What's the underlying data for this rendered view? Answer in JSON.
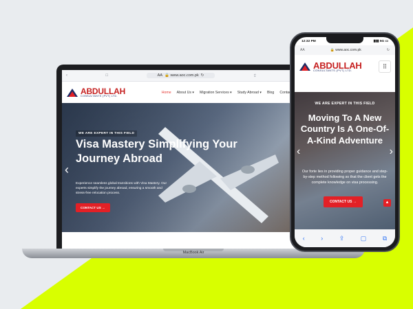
{
  "colors": {
    "brand_red": "#e32026",
    "lime": "#d8ff00",
    "navy": "#1d2b64"
  },
  "laptop": {
    "url": "www.aoc.com.pk",
    "aa": "AA",
    "base_label": "MacBook Air",
    "logo": {
      "main": "ABDULLAH",
      "sub": "CONSULTANTS (PVT) LTD."
    },
    "nav": [
      {
        "label": "Home",
        "active": true
      },
      {
        "label": "About Us ▾"
      },
      {
        "label": "Migration Services ▾"
      },
      {
        "label": "Study Abroad ▾"
      },
      {
        "label": "Blog"
      },
      {
        "label": "Contact Us"
      }
    ],
    "hero": {
      "eyebrow": "WE ARE EXPERT IN THIS FIELD",
      "title": "Visa Mastery Simplifying Your Journey Abroad",
      "description": "Experience seamless global transitions with Visa Mastery. Our experts simplify the journey abroad, ensuring a smooth and stress-free relocation process.",
      "cta": "CONTACT US →"
    }
  },
  "phone": {
    "time": "12:32 PM",
    "signal": "5G",
    "url": "www.aoc.com.pk",
    "aa": "AA",
    "logo": {
      "main": "ABDULLAH",
      "sub": "CONSULTANTS (PVT) LTD."
    },
    "hero": {
      "eyebrow": "WE ARE EXPERT IN THIS FIELD",
      "title": "Moving To A New Country Is A One-Of-A-Kind Adventure",
      "description": "Our forte lies in providing proper guidance and step-by-step method following so that the client gets the complete knowledge on visa processing.",
      "cta": "CONTACT US →"
    }
  }
}
